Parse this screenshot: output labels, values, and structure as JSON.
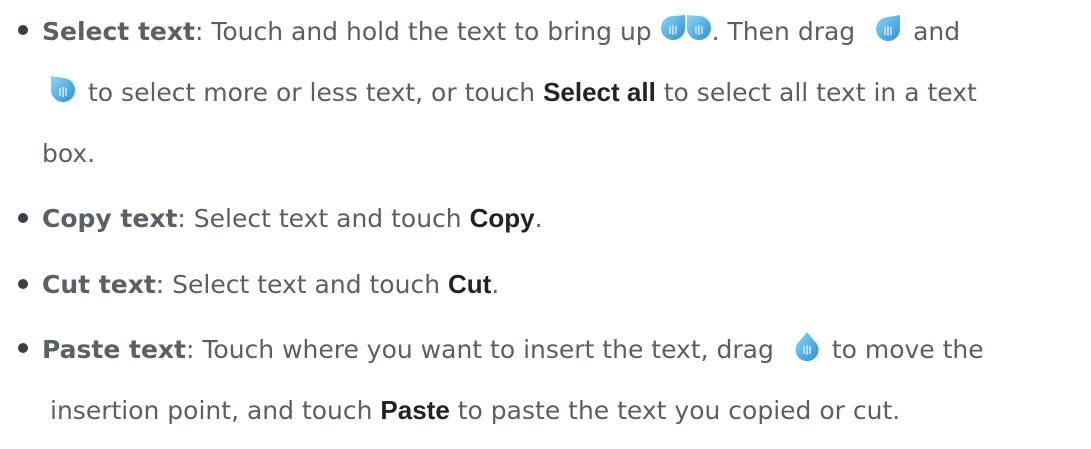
{
  "items": [
    {
      "term": "Select text",
      "line1_a": ": Touch and hold the text to bring up ",
      "line1_b": ". Then drag ",
      "line1_c": "and",
      "line2_a": "to select more or less text, or touch ",
      "line2_bold": "Select all",
      "line2_b": " to select all text in a text",
      "line3": "box.",
      "icons": [
        "selection-handles-pair-icon",
        "left-selection-handle-icon",
        "right-selection-handle-icon"
      ]
    },
    {
      "term": "Copy text",
      "text_a": ": Select text and touch ",
      "bold": "Copy",
      "text_b": "."
    },
    {
      "term": "Cut text",
      "text_a": ": Select text and touch ",
      "bold": "Cut",
      "text_b": "."
    },
    {
      "term": "Paste text",
      "line1_a": ": Touch where you want to insert the text, drag ",
      "line1_b": "to move the",
      "line2_a": "insertion point, and touch ",
      "line2_bold": "Paste",
      "line2_b": " to paste the text you copied or cut.",
      "icons": [
        "insertion-handle-icon"
      ]
    }
  ],
  "colors": {
    "text": "#5a5f66",
    "bold_ui": "#1f2328",
    "handle_light": "#6fc6ef",
    "handle_dark": "#1e90d6"
  }
}
